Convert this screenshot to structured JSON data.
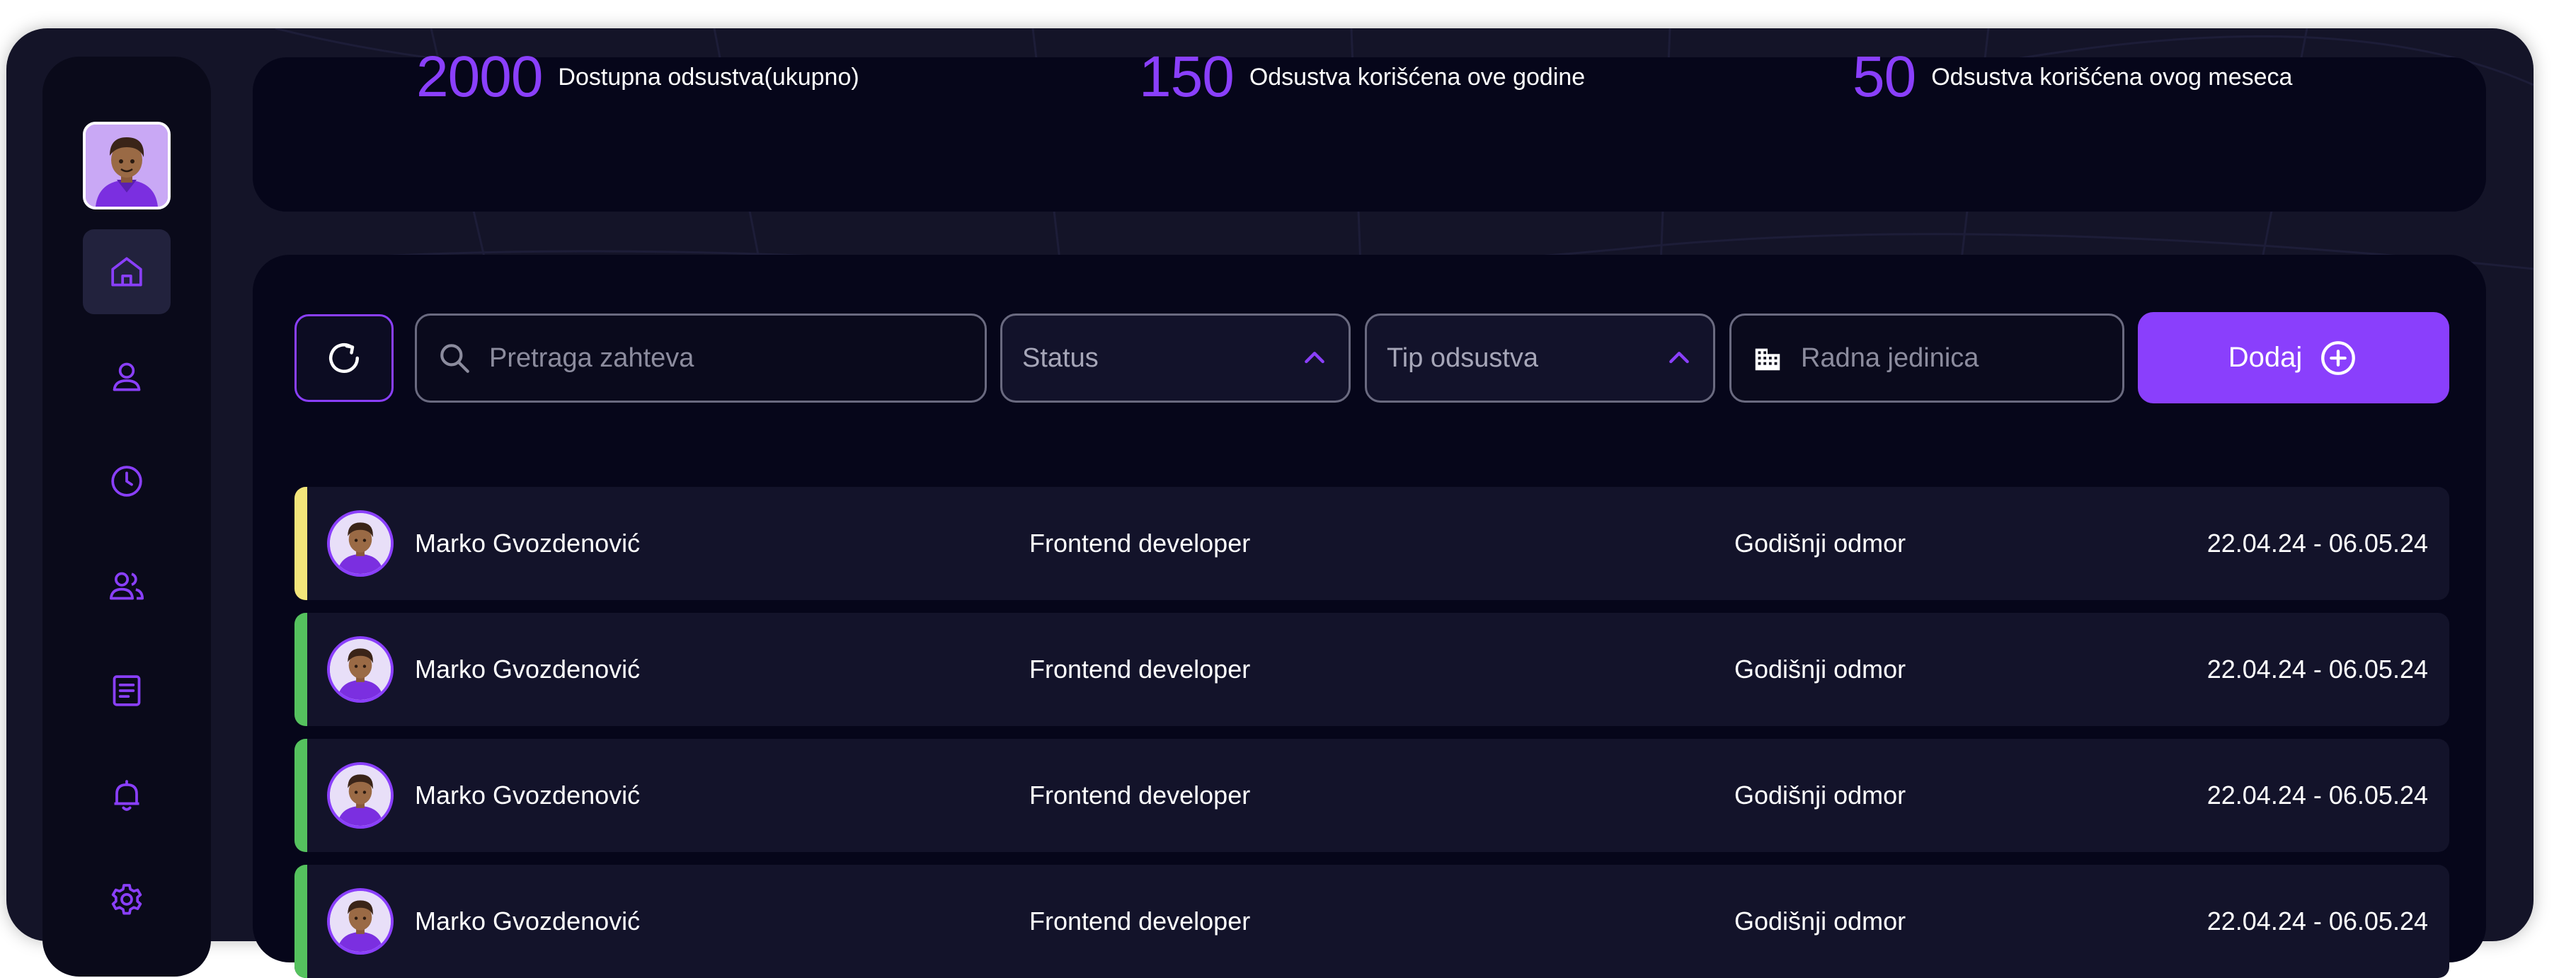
{
  "stats": [
    {
      "value": "2000",
      "label": "Dostupna odsustva(ukupno)"
    },
    {
      "value": "150",
      "label": "Odsustva korišćena ove godine"
    },
    {
      "value": "50",
      "label": "Odsustva korišćena ovog meseca"
    }
  ],
  "sidebar": {
    "items": [
      {
        "icon": "home-icon",
        "active": true
      },
      {
        "icon": "user-icon",
        "active": false
      },
      {
        "icon": "clock-icon",
        "active": false
      },
      {
        "icon": "users-icon",
        "active": false
      },
      {
        "icon": "document-icon",
        "active": false
      },
      {
        "icon": "bell-icon",
        "active": false
      },
      {
        "icon": "gear-icon",
        "active": false
      }
    ]
  },
  "filters": {
    "search_placeholder": "Pretraga zahteva",
    "status_label": "Status",
    "leave_type_label": "Tip odsustva",
    "unit_placeholder": "Radna jedinica",
    "add_label": "Dodaj"
  },
  "rows": [
    {
      "name": "Marko Gvozdenović",
      "role": "Frontend developer",
      "type": "Godišnji odmor",
      "dates": "22.04.24 - 06.05.24",
      "status_color": "#f3e57a"
    },
    {
      "name": "Marko Gvozdenović",
      "role": "Frontend developer",
      "type": "Godišnji odmor",
      "dates": "22.04.24 - 06.05.24",
      "status_color": "#55c25e"
    },
    {
      "name": "Marko Gvozdenović",
      "role": "Frontend developer",
      "type": "Godišnji odmor",
      "dates": "22.04.24 - 06.05.24",
      "status_color": "#55c25e"
    },
    {
      "name": "Marko Gvozdenović",
      "role": "Frontend developer",
      "type": "Godišnji odmor",
      "dates": "22.04.24 - 06.05.24",
      "status_color": "#55c25e"
    }
  ],
  "colors": {
    "accent": "#8a3ffc",
    "background": "#141428",
    "panel": "#06061a"
  }
}
